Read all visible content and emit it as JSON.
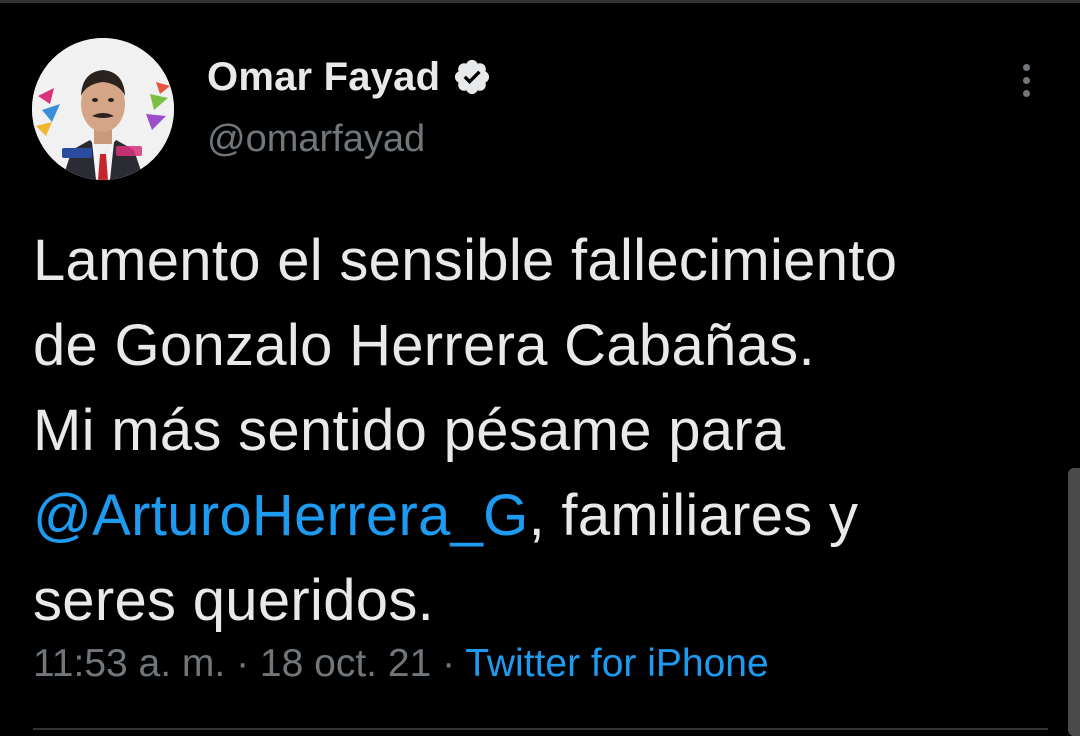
{
  "tweet": {
    "author": {
      "display_name": "Omar Fayad",
      "handle": "@omarfayad",
      "verified": true
    },
    "body_lines": [
      "Lamento el sensible fallecimiento",
      "de Gonzalo Herrera Cabañas.",
      "Mi más sentido pésame para",
      "seres queridos."
    ],
    "mention": "@ArturoHerrera_G",
    "mention_suffix": ", familiares y",
    "meta": {
      "time": "11:53 a. m.",
      "separator": "·",
      "date": "18 oct. 21",
      "source": "Twitter for iPhone"
    }
  },
  "icons": {
    "verified": "verified-badge-icon",
    "more": "more-options-icon"
  },
  "colors": {
    "background": "#000000",
    "text_primary": "#e7e9ea",
    "text_secondary": "#71767b",
    "link": "#1d9bf0"
  }
}
